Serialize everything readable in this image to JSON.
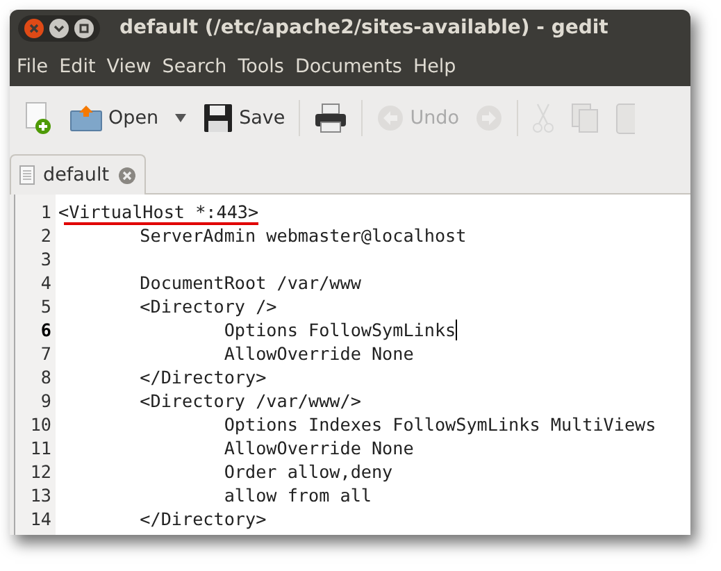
{
  "window": {
    "title": "default (/etc/apache2/sites-available) - gedit"
  },
  "menu": [
    "File",
    "Edit",
    "View",
    "Search",
    "Tools",
    "Documents",
    "Help"
  ],
  "toolbar": [
    {
      "kind": "new",
      "disabled": false
    },
    {
      "kind": "open",
      "label": "Open",
      "disabled": false
    },
    {
      "kind": "dropdown",
      "disabled": false
    },
    {
      "kind": "save",
      "label": "Save",
      "disabled": false
    },
    {
      "kind": "print",
      "disabled": false
    },
    {
      "kind": "undo",
      "label": "Undo",
      "disabled": true
    },
    {
      "kind": "redo",
      "disabled": true
    },
    {
      "kind": "cut",
      "disabled": true
    },
    {
      "kind": "copy",
      "disabled": true
    },
    {
      "kind": "paste",
      "disabled": true
    }
  ],
  "tabs": [
    {
      "label": "default",
      "selected": true
    }
  ],
  "editor": {
    "lines": [
      {
        "number": "1",
        "text": "<VirtualHost *:443>",
        "current": false,
        "underlined": true
      },
      {
        "number": "2",
        "text": "\tServerAdmin webmaster@localhost",
        "current": false,
        "underlined": false
      },
      {
        "number": "3",
        "current": false,
        "underlined": false
      },
      {
        "number": "4",
        "text": "\tDocumentRoot /var/www",
        "current": false,
        "underlined": false
      },
      {
        "number": "5",
        "text": "\t<Directory />",
        "current": false,
        "underlined": false
      },
      {
        "number": "6",
        "text": "\t\tOptions FollowSymLinks",
        "current": true,
        "underlined": false
      },
      {
        "number": "7",
        "text": "\t\tAllowOverride None",
        "current": false,
        "underlined": false
      },
      {
        "number": "8",
        "text": "\t</Directory>",
        "current": false,
        "underlined": false
      },
      {
        "number": "9",
        "text": "\t<Directory /var/www/>",
        "current": false,
        "underlined": false
      },
      {
        "number": "10",
        "text": "\t\tOptions Indexes FollowSymLinks MultiViews",
        "current": false,
        "underlined": false
      },
      {
        "number": "11",
        "text": "\t\tAllowOverride None",
        "current": false,
        "underlined": false
      },
      {
        "number": "12",
        "text": "\t\tOrder allow,deny",
        "current": false,
        "underlined": false
      },
      {
        "number": "13",
        "text": "\t\tallow from all",
        "current": false,
        "underlined": false
      },
      {
        "number": "14",
        "text": "\t</Directory>",
        "current": false,
        "underlined": false
      }
    ]
  }
}
